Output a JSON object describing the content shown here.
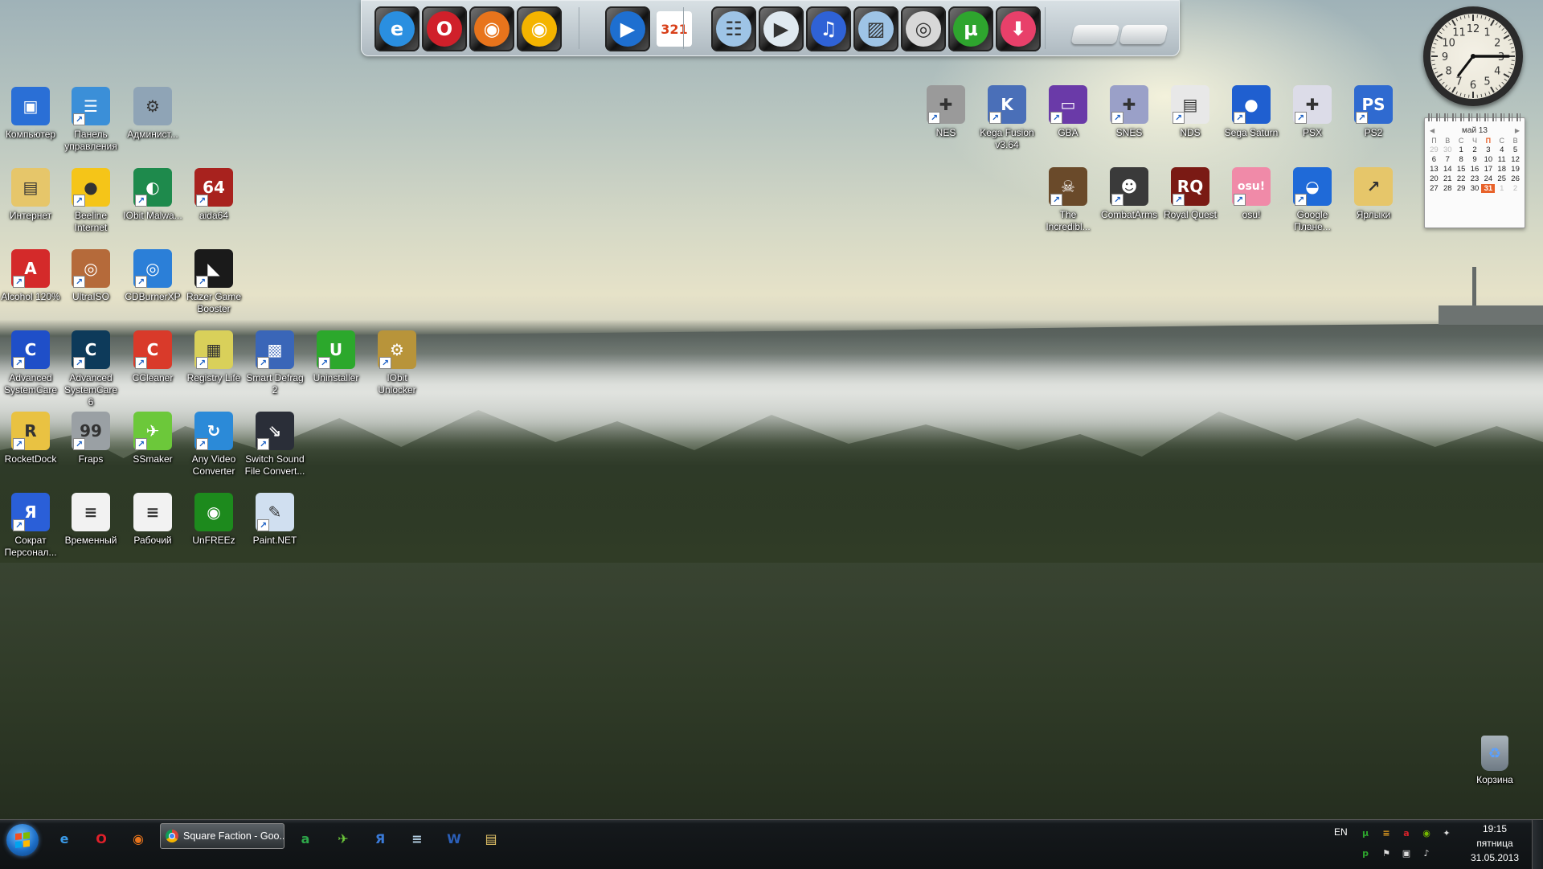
{
  "dock": {
    "items": [
      {
        "name": "internet-explorer",
        "glyph": "e",
        "color": "#2a8fe0"
      },
      {
        "name": "opera",
        "glyph": "O",
        "color": "#d0202a"
      },
      {
        "name": "firefox",
        "glyph": "◉",
        "color": "#e8741c"
      },
      {
        "name": "chrome",
        "glyph": "◉",
        "color": "#f4b400"
      },
      {
        "name": "windows-media-player",
        "glyph": "▶",
        "color": "#1e6fd0"
      },
      {
        "name": "media-player-classic",
        "glyph": "321",
        "color": "#ffffff"
      },
      {
        "name": "documents-folder",
        "glyph": "☷",
        "color": "#9ec4e6"
      },
      {
        "name": "videos-folder",
        "glyph": "▶",
        "color": "#dfe9f0"
      },
      {
        "name": "music-folder",
        "glyph": "♫",
        "color": "#2f62d6"
      },
      {
        "name": "pictures-folder",
        "glyph": "▨",
        "color": "#9ec4e6"
      },
      {
        "name": "disc-drive",
        "glyph": "◎",
        "color": "#d8d8d8"
      },
      {
        "name": "utorrent",
        "glyph": "µ",
        "color": "#2ea52e"
      },
      {
        "name": "downloads-folder",
        "glyph": "⬇",
        "color": "#e8406a"
      }
    ],
    "drives": [
      "system-drive",
      "data-drive"
    ]
  },
  "desktop_left": [
    {
      "label": "Компьютер",
      "icon": "computer-icon",
      "glyph": "▣",
      "bg": "#2a6fd6",
      "shortcut": false
    },
    {
      "label": "Панель управления",
      "icon": "control-panel-icon",
      "glyph": "☰",
      "bg": "#3b8fd8",
      "shortcut": true
    },
    {
      "label": "Админист...",
      "icon": "admin-tools-icon",
      "glyph": "⚙",
      "bg": "#8fa4b6",
      "shortcut": false
    },
    {
      "label": "Интернет",
      "icon": "folder-icon",
      "glyph": "▤",
      "bg": "#e6c66a",
      "shortcut": false
    },
    {
      "label": "Beeline Internet",
      "icon": "beeline-icon",
      "glyph": "●",
      "bg": "#f5c518",
      "shortcut": true
    },
    {
      "label": "IObit Malwa...",
      "icon": "iobit-malware-icon",
      "glyph": "◐",
      "bg": "#1e8a4c",
      "shortcut": true
    },
    {
      "label": "aida64",
      "icon": "aida64-icon",
      "glyph": "64",
      "bg": "#a8221e",
      "shortcut": true
    },
    {
      "label": "Alcohol 120%",
      "icon": "alcohol-icon",
      "glyph": "A",
      "bg": "#d42a2a",
      "shortcut": true
    },
    {
      "label": "UltraISO",
      "icon": "ultraiso-icon",
      "glyph": "◎",
      "bg": "#b56a3a",
      "shortcut": true
    },
    {
      "label": "CDBurnerXP",
      "icon": "cdburner-icon",
      "glyph": "◎",
      "bg": "#2b7fd8",
      "shortcut": true
    },
    {
      "label": "Razer Game Booster",
      "icon": "razer-icon",
      "glyph": "◣",
      "bg": "#1a1a1a",
      "shortcut": true
    },
    {
      "label": "Advanced SystemCare",
      "icon": "asc-icon",
      "glyph": "C",
      "bg": "#1f4fc8",
      "shortcut": true
    },
    {
      "label": "Advanced SystemCare 6",
      "icon": "asc6-icon",
      "glyph": "C",
      "bg": "#0d3a5a",
      "shortcut": true
    },
    {
      "label": "CCleaner",
      "icon": "ccleaner-icon",
      "glyph": "C",
      "bg": "#d93a2a",
      "shortcut": true
    },
    {
      "label": "Registry Life",
      "icon": "registry-life-icon",
      "glyph": "▦",
      "bg": "#d9d05a",
      "shortcut": true
    },
    {
      "label": "Smart Defrag 2",
      "icon": "smart-defrag-icon",
      "glyph": "▩",
      "bg": "#3a66b8",
      "shortcut": true
    },
    {
      "label": "Uninstaller",
      "icon": "uninstaller-icon",
      "glyph": "U",
      "bg": "#2ca82c",
      "shortcut": true
    },
    {
      "label": "IObit Unlocker",
      "icon": "unlocker-icon",
      "glyph": "⚙",
      "bg": "#b8943a",
      "shortcut": true
    },
    {
      "label": "RocketDock",
      "icon": "rocketdock-icon",
      "glyph": "R",
      "bg": "#e9c242",
      "shortcut": true
    },
    {
      "label": "Fraps",
      "icon": "fraps-icon",
      "glyph": "99",
      "bg": "#9aa0a4",
      "shortcut": true
    },
    {
      "label": "SSmaker",
      "icon": "ssmaker-icon",
      "glyph": "✈",
      "bg": "#6cc83a",
      "shortcut": true
    },
    {
      "label": "Any Video Converter",
      "icon": "any-video-icon",
      "glyph": "↻",
      "bg": "#2b8ad8",
      "shortcut": true
    },
    {
      "label": "Switch Sound File Convert...",
      "icon": "switch-sound-icon",
      "glyph": "⇘",
      "bg": "#2a2e38",
      "shortcut": true
    },
    {
      "label": "Сократ Персонал...",
      "icon": "sokrat-icon",
      "glyph": "Я",
      "bg": "#2a5fd8",
      "shortcut": true
    },
    {
      "label": "Временный",
      "icon": "text-file-icon",
      "glyph": "≡",
      "bg": "#f2f2f2",
      "shortcut": false
    },
    {
      "label": "Рабочий",
      "icon": "text-file-icon",
      "glyph": "≡",
      "bg": "#f2f2f2",
      "shortcut": false
    },
    {
      "label": "UnFREEz",
      "icon": "unfreez-icon",
      "glyph": "◉",
      "bg": "#1d8a1d",
      "shortcut": false
    },
    {
      "label": "Paint.NET",
      "icon": "paintnet-icon",
      "glyph": "✎",
      "bg": "#d0dff0",
      "shortcut": true
    }
  ],
  "desktop_right": [
    {
      "label": "NES",
      "icon": "nes-icon",
      "glyph": "✚",
      "bg": "#9a9a9a"
    },
    {
      "label": "Kega Fusion v3.64",
      "icon": "kega-fusion-icon",
      "glyph": "K",
      "bg": "#4a6fb8"
    },
    {
      "label": "GBA",
      "icon": "gba-icon",
      "glyph": "▭",
      "bg": "#6a3aa8"
    },
    {
      "label": "SNES",
      "icon": "snes-icon",
      "glyph": "✚",
      "bg": "#9aa0c8"
    },
    {
      "label": "NDS",
      "icon": "nds-icon",
      "glyph": "▤",
      "bg": "#e8e8e8"
    },
    {
      "label": "Sega Saturn",
      "icon": "sega-saturn-icon",
      "glyph": "●",
      "bg": "#1f5fd0"
    },
    {
      "label": "PSX",
      "icon": "psx-icon",
      "glyph": "✚",
      "bg": "#dcdce8"
    },
    {
      "label": "PS2",
      "icon": "ps2-icon",
      "glyph": "PS",
      "bg": "#2f6ad0"
    },
    {
      "label": "The Incredibl...",
      "icon": "incredible-icon",
      "glyph": "☠",
      "bg": "#6a4a2a"
    },
    {
      "label": "CombatArms",
      "icon": "combatarms-icon",
      "glyph": "☻",
      "bg": "#3a3a3a"
    },
    {
      "label": "Royal Quest",
      "icon": "royal-quest-icon",
      "glyph": "RQ",
      "bg": "#7a1a14"
    },
    {
      "label": "osu!",
      "icon": "osu-icon",
      "glyph": "osu!",
      "bg": "#f08aa8"
    },
    {
      "label": "Google Плане...",
      "icon": "google-earth-icon",
      "glyph": "◒",
      "bg": "#1f6ad8"
    },
    {
      "label": "Ярлыки",
      "icon": "folder-icon",
      "glyph": "↗",
      "bg": "#e6c66a"
    }
  ],
  "recycle_bin": {
    "label": "Корзина"
  },
  "clock_gadget": {
    "hour": 19,
    "minute": 15,
    "numbers": [
      "12",
      "1",
      "2",
      "3",
      "4",
      "5",
      "6",
      "7",
      "8",
      "9",
      "10",
      "11"
    ]
  },
  "calendar": {
    "month_label": "май 13",
    "prev": "◀",
    "next": "▶",
    "weekdays": [
      "П",
      "В",
      "С",
      "Ч",
      "П",
      "С",
      "В"
    ],
    "today_weekday_index": 4,
    "weeks": [
      [
        {
          "d": "29",
          "o": true
        },
        {
          "d": "30",
          "o": true
        },
        {
          "d": "1"
        },
        {
          "d": "2"
        },
        {
          "d": "3"
        },
        {
          "d": "4"
        },
        {
          "d": "5"
        }
      ],
      [
        {
          "d": "6"
        },
        {
          "d": "7"
        },
        {
          "d": "8"
        },
        {
          "d": "9"
        },
        {
          "d": "10"
        },
        {
          "d": "11"
        },
        {
          "d": "12"
        }
      ],
      [
        {
          "d": "13"
        },
        {
          "d": "14"
        },
        {
          "d": "15"
        },
        {
          "d": "16"
        },
        {
          "d": "17"
        },
        {
          "d": "18"
        },
        {
          "d": "19"
        }
      ],
      [
        {
          "d": "20"
        },
        {
          "d": "21"
        },
        {
          "d": "22"
        },
        {
          "d": "23"
        },
        {
          "d": "24"
        },
        {
          "d": "25"
        },
        {
          "d": "26"
        }
      ],
      [
        {
          "d": "27"
        },
        {
          "d": "28"
        },
        {
          "d": "29"
        },
        {
          "d": "30"
        },
        {
          "d": "31",
          "t": true
        },
        {
          "d": "1",
          "o": true
        },
        {
          "d": "2",
          "o": true
        }
      ]
    ]
  },
  "taskbar": {
    "pinned_left": [
      {
        "name": "internet-explorer",
        "glyph": "e",
        "color": "#3a9ae8"
      },
      {
        "name": "opera",
        "glyph": "O",
        "color": "#e0202a"
      },
      {
        "name": "firefox",
        "glyph": "◉",
        "color": "#e8741c"
      }
    ],
    "active_window": {
      "title": "Square Faction - Goo..."
    },
    "pinned_right": [
      {
        "name": "antivirus",
        "glyph": "a",
        "color": "#2ea84a"
      },
      {
        "name": "ssmaker",
        "glyph": "✈",
        "color": "#6cc83a"
      },
      {
        "name": "sokrat",
        "glyph": "Я",
        "color": "#3a7ad8"
      },
      {
        "name": "notepad",
        "glyph": "≡",
        "color": "#b8d4e8"
      },
      {
        "name": "word",
        "glyph": "W",
        "color": "#2b5fb8"
      },
      {
        "name": "explorer",
        "glyph": "▤",
        "color": "#e6c66a"
      }
    ],
    "language": "EN",
    "tray_top": [
      {
        "name": "utorrent-tray",
        "glyph": "µ",
        "color": "#2ea52e"
      },
      {
        "name": "iobit-tray",
        "glyph": "≡",
        "color": "#e8a020"
      },
      {
        "name": "avira-tray",
        "glyph": "a",
        "color": "#d8222a"
      },
      {
        "name": "nvidia-tray",
        "glyph": "◉",
        "color": "#76b900"
      },
      {
        "name": "satellite-tray",
        "glyph": "✦",
        "color": "#dddddd"
      }
    ],
    "tray_bottom": [
      {
        "name": "punto-tray",
        "glyph": "p",
        "color": "#2ea52e"
      },
      {
        "name": "action-center-tray",
        "glyph": "⚑",
        "color": "#dddddd"
      },
      {
        "name": "network-tray",
        "glyph": "▣",
        "color": "#dddddd"
      },
      {
        "name": "volume-tray",
        "glyph": "♪",
        "color": "#dddddd"
      }
    ],
    "time": "19:15",
    "weekday": "пятница",
    "date": "31.05.2013"
  }
}
